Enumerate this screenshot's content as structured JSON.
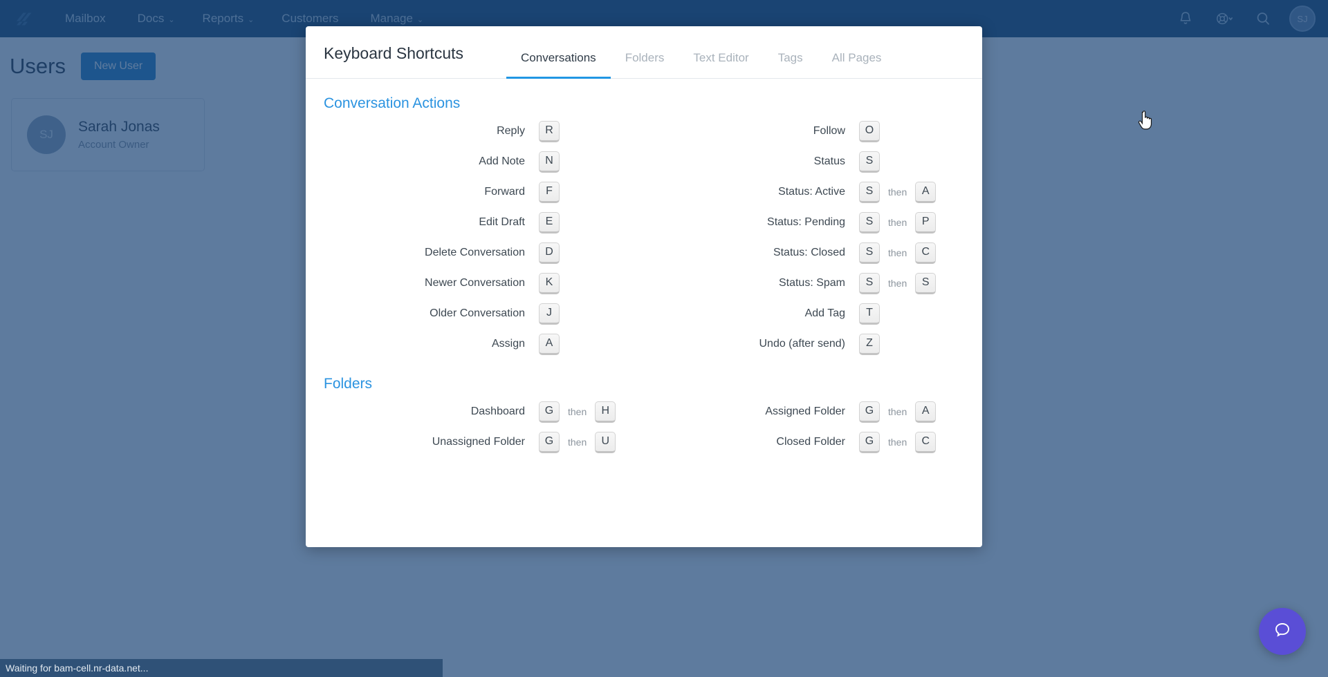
{
  "navbar": {
    "logo_icon": "helpscout-logo-icon",
    "links": [
      {
        "label": "Mailbox",
        "caret": ""
      },
      {
        "label": "Docs",
        "caret": "⌄"
      },
      {
        "label": "Reports",
        "caret": "⌄"
      },
      {
        "label": "Customers",
        "caret": ""
      },
      {
        "label": "Manage",
        "caret": "⌄"
      }
    ],
    "icons": [
      "bell-icon",
      "life-ring-icon",
      "search-icon"
    ],
    "support_caret": "⌄",
    "avatar_initials": "SJ"
  },
  "page": {
    "title": "Users",
    "new_user_label": "New User",
    "user": {
      "initials": "SJ",
      "name": "Sarah Jonas",
      "role": "Account Owner"
    }
  },
  "modal": {
    "title": "Keyboard Shortcuts",
    "tabs": [
      {
        "label": "Conversations",
        "active": true
      },
      {
        "label": "Folders",
        "active": false
      },
      {
        "label": "Text Editor",
        "active": false
      },
      {
        "label": "Tags",
        "active": false
      },
      {
        "label": "All Pages",
        "active": false
      }
    ],
    "sections": [
      {
        "title": "Conversation Actions",
        "left": [
          {
            "label": "Reply",
            "key1": "R",
            "then": "",
            "key2": ""
          },
          {
            "label": "Add Note",
            "key1": "N",
            "then": "",
            "key2": ""
          },
          {
            "label": "Forward",
            "key1": "F",
            "then": "",
            "key2": ""
          },
          {
            "label": "Edit Draft",
            "key1": "E",
            "then": "",
            "key2": ""
          },
          {
            "label": "Delete Conversation",
            "key1": "D",
            "then": "",
            "key2": ""
          },
          {
            "label": "Newer Conversation",
            "key1": "K",
            "then": "",
            "key2": ""
          },
          {
            "label": "Older Conversation",
            "key1": "J",
            "then": "",
            "key2": ""
          },
          {
            "label": "Assign",
            "key1": "A",
            "then": "",
            "key2": ""
          }
        ],
        "right": [
          {
            "label": "Follow",
            "key1": "O",
            "then": "",
            "key2": ""
          },
          {
            "label": "Status",
            "key1": "S",
            "then": "",
            "key2": ""
          },
          {
            "label": "Status: Active",
            "key1": "S",
            "then": "then",
            "key2": "A"
          },
          {
            "label": "Status: Pending",
            "key1": "S",
            "then": "then",
            "key2": "P"
          },
          {
            "label": "Status: Closed",
            "key1": "S",
            "then": "then",
            "key2": "C"
          },
          {
            "label": "Status: Spam",
            "key1": "S",
            "then": "then",
            "key2": "S"
          },
          {
            "label": "Add Tag",
            "key1": "T",
            "then": "",
            "key2": ""
          },
          {
            "label": "Undo (after send)",
            "key1": "Z",
            "then": "",
            "key2": ""
          }
        ]
      },
      {
        "title": "Folders",
        "left": [
          {
            "label": "Dashboard",
            "key1": "G",
            "then": "then",
            "key2": "H"
          },
          {
            "label": "Unassigned Folder",
            "key1": "G",
            "then": "then",
            "key2": "U"
          }
        ],
        "right": [
          {
            "label": "Assigned Folder",
            "key1": "G",
            "then": "then",
            "key2": "A"
          },
          {
            "label": "Closed Folder",
            "key1": "G",
            "then": "then",
            "key2": "C"
          }
        ]
      }
    ]
  },
  "statusbar": {
    "text": "Waiting for bam-cell.nr-data.net..."
  },
  "beacon": {
    "icon": "chat-bubble-icon"
  },
  "colors": {
    "navbar": "#0c3c66",
    "accent": "#2b93e0",
    "primary_button": "#1878c0",
    "tab_underline": "#2196e3",
    "beacon": "#5a4ed6",
    "overlay": "#4a678f"
  }
}
